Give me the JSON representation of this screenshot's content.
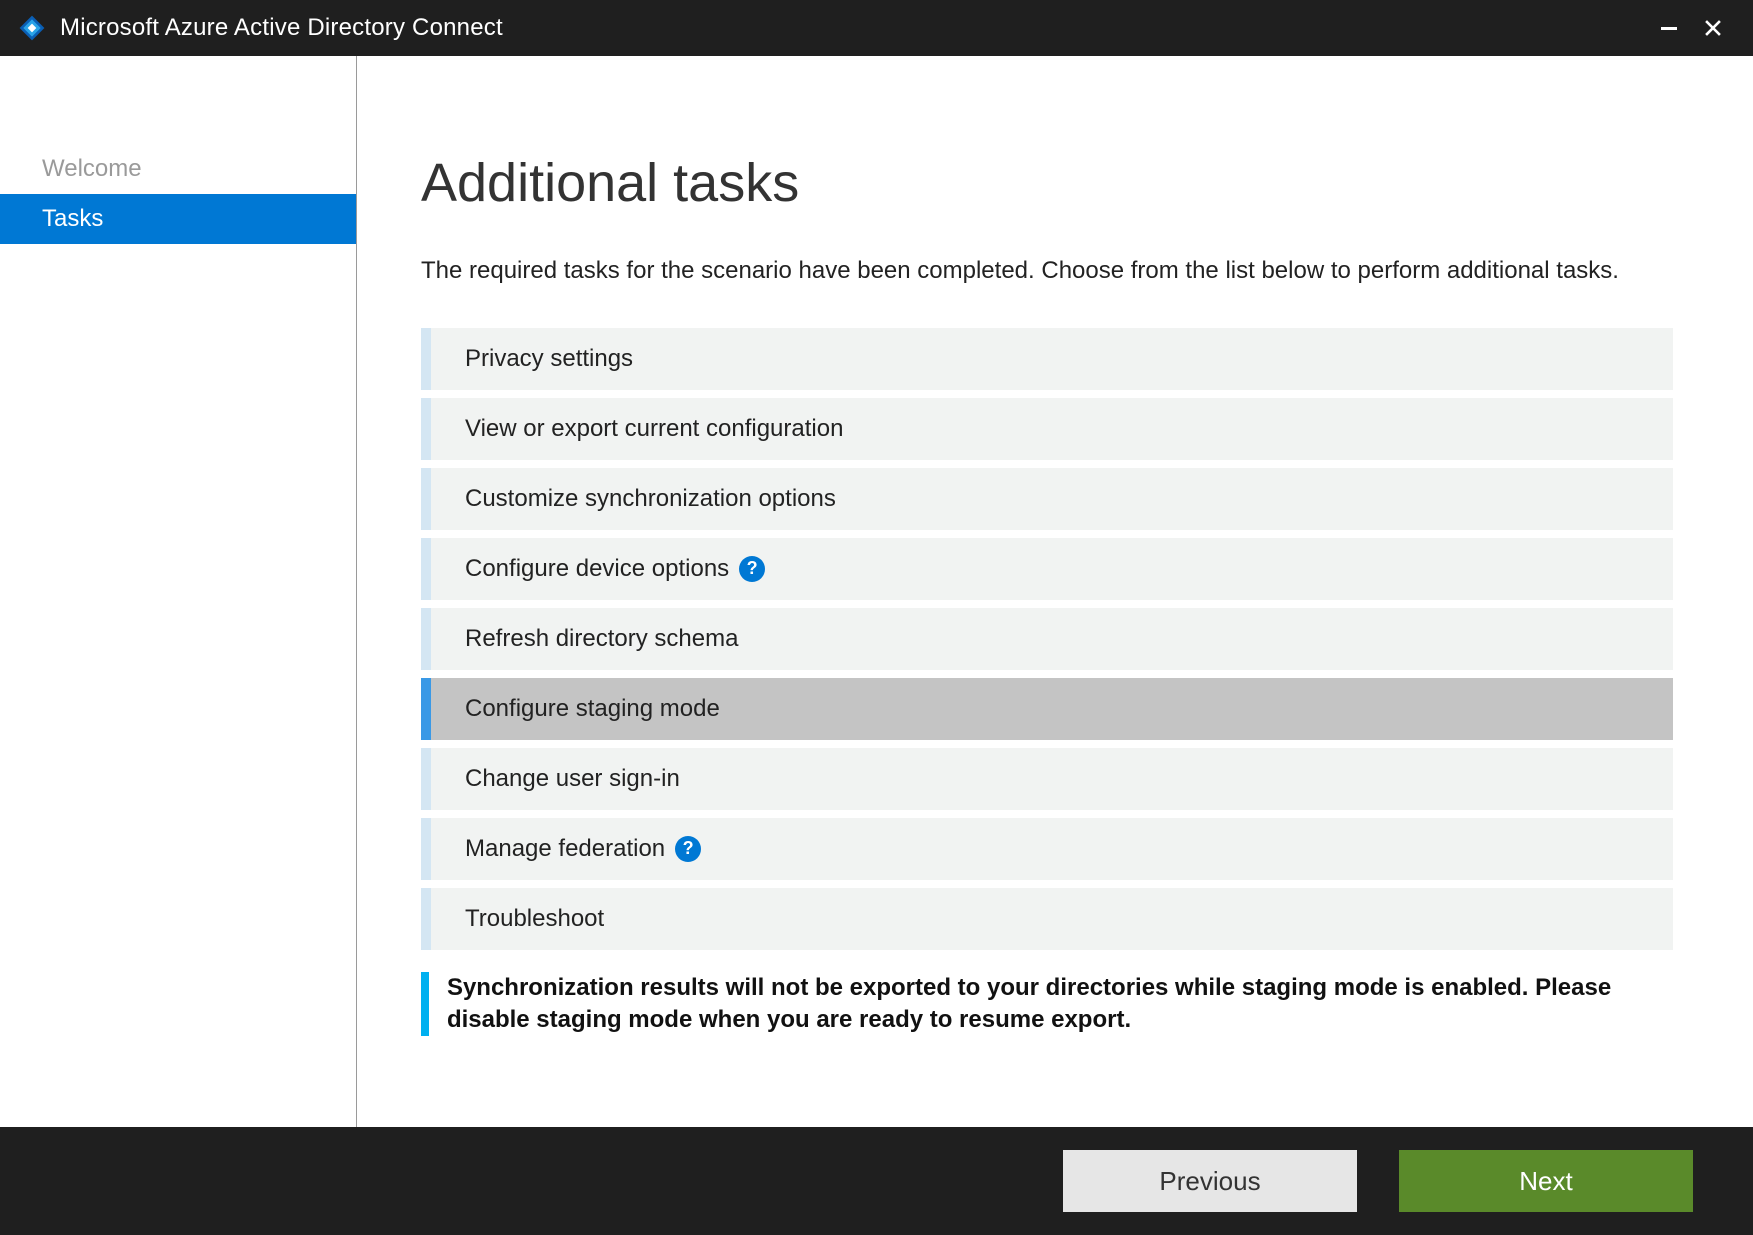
{
  "window": {
    "title": "Microsoft Azure Active Directory Connect"
  },
  "sidebar": {
    "items": [
      {
        "label": "Welcome",
        "active": false
      },
      {
        "label": "Tasks",
        "active": true
      }
    ]
  },
  "main": {
    "heading": "Additional tasks",
    "intro": "The required tasks for the scenario have been completed. Choose from the list below to perform additional tasks.",
    "tasks": [
      {
        "label": "Privacy settings",
        "help": false,
        "selected": false
      },
      {
        "label": "View or export current configuration",
        "help": false,
        "selected": false
      },
      {
        "label": "Customize synchronization options",
        "help": false,
        "selected": false
      },
      {
        "label": "Configure device options",
        "help": true,
        "selected": false
      },
      {
        "label": "Refresh directory schema",
        "help": false,
        "selected": false
      },
      {
        "label": "Configure staging mode",
        "help": false,
        "selected": true
      },
      {
        "label": "Change user sign-in",
        "help": false,
        "selected": false
      },
      {
        "label": "Manage federation",
        "help": true,
        "selected": false
      },
      {
        "label": "Troubleshoot",
        "help": false,
        "selected": false
      }
    ],
    "notice": "Synchronization results will not be exported to your directories while staging mode is enabled. Please disable staging mode when you are ready to resume export."
  },
  "footer": {
    "previous": "Previous",
    "next": "Next"
  },
  "glyphs": {
    "help": "?"
  }
}
